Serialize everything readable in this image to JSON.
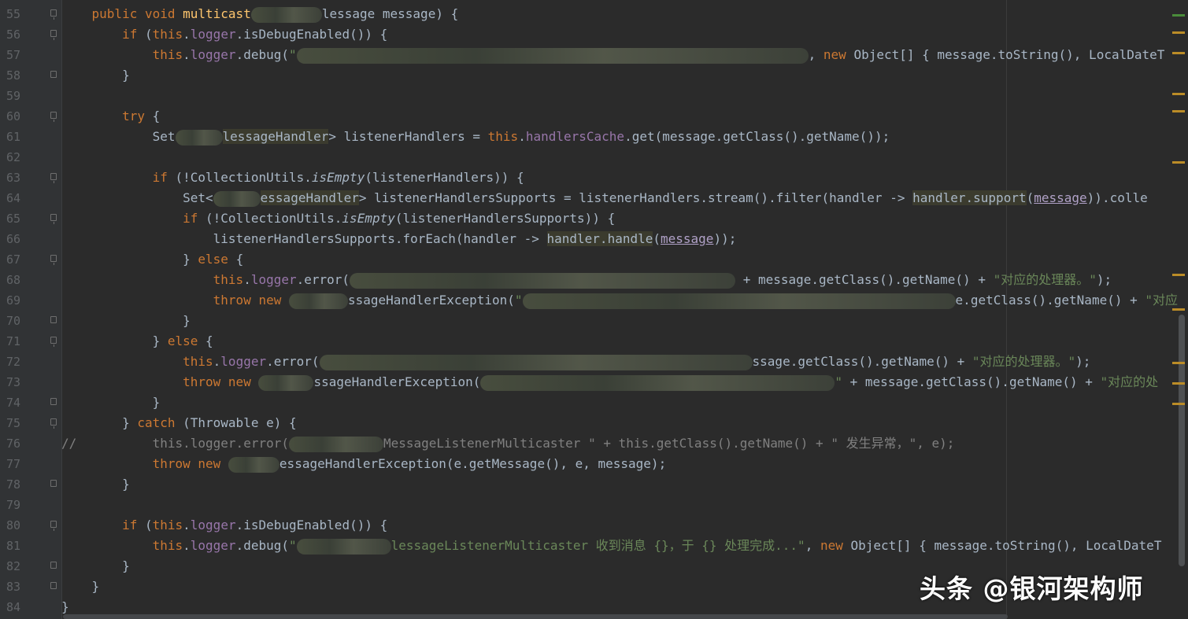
{
  "editor": {
    "lines": [
      {
        "n": "55",
        "fold": "open",
        "segs": [
          [
            "    ",
            ""
          ],
          [
            "public void ",
            "kw"
          ],
          [
            "multicast",
            "fn"
          ],
          [
            "BLUR90",
            ""
          ],
          [
            "lessage message) {",
            ""
          ]
        ]
      },
      {
        "n": "56",
        "fold": "open",
        "segs": [
          [
            "        ",
            ""
          ],
          [
            "if ",
            "kw"
          ],
          [
            "(",
            ""
          ],
          [
            "this",
            "kw"
          ],
          [
            ".",
            ""
          ],
          [
            "logger",
            "fld"
          ],
          [
            ".isDebugEnabled()) {",
            ""
          ]
        ]
      },
      {
        "n": "57",
        "fold": "",
        "segs": [
          [
            "            ",
            ""
          ],
          [
            "this",
            "kw"
          ],
          [
            ".",
            ""
          ],
          [
            "logger",
            "fld"
          ],
          [
            ".debug(",
            ""
          ],
          [
            "\"",
            "str"
          ],
          [
            "BLUR650",
            ""
          ],
          [
            ", ",
            ""
          ],
          [
            "new ",
            "kw"
          ],
          [
            "Object[] { message.toString(), LocalDateT",
            ""
          ]
        ]
      },
      {
        "n": "58",
        "fold": "closed",
        "segs": [
          [
            "        }",
            ""
          ]
        ]
      },
      {
        "n": "59",
        "fold": "",
        "segs": [
          [
            "",
            ""
          ]
        ]
      },
      {
        "n": "60",
        "fold": "open",
        "segs": [
          [
            "        ",
            ""
          ],
          [
            "try ",
            "kw"
          ],
          [
            "{",
            ""
          ]
        ]
      },
      {
        "n": "61",
        "fold": "",
        "segs": [
          [
            "            Set",
            ""
          ],
          [
            "BLUR60",
            ""
          ],
          [
            "lessageHandler",
            "hl2"
          ],
          [
            "> listenerHandlers = ",
            ""
          ],
          [
            "this",
            "kw"
          ],
          [
            ".",
            ""
          ],
          [
            "handlersCache",
            "fld"
          ],
          [
            ".get(message.getClass().getName());",
            ""
          ]
        ]
      },
      {
        "n": "62",
        "fold": "",
        "segs": [
          [
            "",
            ""
          ]
        ]
      },
      {
        "n": "63",
        "fold": "open",
        "segs": [
          [
            "            ",
            ""
          ],
          [
            "if ",
            "kw"
          ],
          [
            "(!CollectionUtils.",
            ""
          ],
          [
            "isEmpty",
            "it"
          ],
          [
            "(listenerHandlers)) {",
            ""
          ]
        ]
      },
      {
        "n": "64",
        "fold": "",
        "segs": [
          [
            "                Set<",
            ""
          ],
          [
            "BLUR60",
            ""
          ],
          [
            "essageHandler",
            "hl2"
          ],
          [
            "> listenerHandlersSupports = listenerHandlers.stream().filter(handler -> ",
            ""
          ],
          [
            "handler.support",
            "hl2"
          ],
          [
            "(",
            ""
          ],
          [
            "message",
            "ul"
          ],
          [
            ")).colle",
            ""
          ]
        ]
      },
      {
        "n": "65",
        "fold": "open",
        "segs": [
          [
            "                ",
            ""
          ],
          [
            "if ",
            "kw"
          ],
          [
            "(!CollectionUtils.",
            ""
          ],
          [
            "isEmpty",
            "it"
          ],
          [
            "(listenerHandlersSupports)) {",
            ""
          ]
        ]
      },
      {
        "n": "66",
        "fold": "",
        "segs": [
          [
            "                    listenerHandlersSupports.forEach(handler -> ",
            ""
          ],
          [
            "handler.handle",
            "hl2"
          ],
          [
            "(",
            ""
          ],
          [
            "message",
            "ul"
          ],
          [
            "));",
            ""
          ]
        ]
      },
      {
        "n": "67",
        "fold": "open",
        "segs": [
          [
            "                } ",
            ""
          ],
          [
            "else ",
            "kw"
          ],
          [
            "{",
            ""
          ]
        ]
      },
      {
        "n": "68",
        "fold": "",
        "segs": [
          [
            "                    ",
            ""
          ],
          [
            "this",
            "kw"
          ],
          [
            ".",
            ""
          ],
          [
            "logger",
            "fld"
          ],
          [
            ".error(",
            ""
          ],
          [
            "BLUR490",
            ""
          ],
          [
            " + message.getClass().getName() + ",
            ""
          ],
          [
            "\"对应的处理器。\"",
            "str"
          ],
          [
            ");",
            ""
          ]
        ]
      },
      {
        "n": "69",
        "fold": "",
        "segs": [
          [
            "                    ",
            ""
          ],
          [
            "throw new ",
            "kw"
          ],
          [
            "BLUR75",
            ""
          ],
          [
            "ssageHandlerException(",
            ""
          ],
          [
            "\"",
            "str"
          ],
          [
            "BLUR550",
            ""
          ],
          [
            "e.getClass().getName() + ",
            ""
          ],
          [
            "\"对应",
            "str"
          ]
        ]
      },
      {
        "n": "70",
        "fold": "closed",
        "segs": [
          [
            "                }",
            ""
          ]
        ]
      },
      {
        "n": "71",
        "fold": "open",
        "segs": [
          [
            "            } ",
            ""
          ],
          [
            "else ",
            "kw"
          ],
          [
            "{",
            ""
          ]
        ]
      },
      {
        "n": "72",
        "fold": "",
        "segs": [
          [
            "                ",
            ""
          ],
          [
            "this",
            "kw"
          ],
          [
            ".",
            ""
          ],
          [
            "logger",
            "fld"
          ],
          [
            ".error(",
            ""
          ],
          [
            "BLUR550",
            ""
          ],
          [
            "ssage.getClass().getName() + ",
            ""
          ],
          [
            "\"对应的处理器。\"",
            "str"
          ],
          [
            ");",
            ""
          ]
        ]
      },
      {
        "n": "73",
        "fold": "",
        "segs": [
          [
            "                ",
            ""
          ],
          [
            "throw new ",
            "kw"
          ],
          [
            "BLUR70",
            ""
          ],
          [
            "ssageHandlerException(",
            ""
          ],
          [
            "BLUR450",
            ""
          ],
          [
            "\"",
            "str"
          ],
          [
            " + message.getClass().getName() + ",
            ""
          ],
          [
            "\"对应的处",
            "str"
          ]
        ]
      },
      {
        "n": "74",
        "fold": "closed",
        "segs": [
          [
            "            }",
            ""
          ]
        ]
      },
      {
        "n": "75",
        "fold": "open",
        "segs": [
          [
            "        } ",
            ""
          ],
          [
            "catch ",
            "kw"
          ],
          [
            "(Throwable e) {",
            ""
          ]
        ]
      },
      {
        "n": "76",
        "fold": "",
        "segs": [
          [
            "//          this.logger.error(",
            "cm"
          ],
          [
            "BLUR120",
            ""
          ],
          [
            "MessageListenerMulticaster \" + this.getClass().getName() + \" 发生异常，\", e);",
            "cm"
          ]
        ]
      },
      {
        "n": "77",
        "fold": "",
        "segs": [
          [
            "            ",
            ""
          ],
          [
            "throw new ",
            "kw"
          ],
          [
            "BLUR65",
            ""
          ],
          [
            "essageHandlerException(e.getMessage(), e, message);",
            ""
          ]
        ]
      },
      {
        "n": "78",
        "fold": "closed",
        "segs": [
          [
            "        }",
            ""
          ]
        ]
      },
      {
        "n": "79",
        "fold": "",
        "segs": [
          [
            "",
            ""
          ]
        ]
      },
      {
        "n": "80",
        "fold": "open",
        "segs": [
          [
            "        ",
            ""
          ],
          [
            "if ",
            "kw"
          ],
          [
            "(",
            ""
          ],
          [
            "this",
            "kw"
          ],
          [
            ".",
            ""
          ],
          [
            "logger",
            "fld"
          ],
          [
            ".isDebugEnabled()) {",
            ""
          ]
        ]
      },
      {
        "n": "81",
        "fold": "",
        "segs": [
          [
            "            ",
            ""
          ],
          [
            "this",
            "kw"
          ],
          [
            ".",
            ""
          ],
          [
            "logger",
            "fld"
          ],
          [
            ".debug(",
            ""
          ],
          [
            "\"",
            "str"
          ],
          [
            "BLUR120",
            ""
          ],
          [
            "lessageListenerMulticaster 收到消息 {}，于 {} 处理完成...\"",
            "str"
          ],
          [
            ", ",
            ""
          ],
          [
            "new ",
            "kw"
          ],
          [
            "Object[] { message.toString(), LocalDateT",
            ""
          ]
        ]
      },
      {
        "n": "82",
        "fold": "closed",
        "segs": [
          [
            "        }",
            ""
          ]
        ]
      },
      {
        "n": "83",
        "fold": "closed",
        "segs": [
          [
            "    }",
            ""
          ]
        ]
      },
      {
        "n": "84",
        "fold": "",
        "segs": [
          [
            "}",
            ""
          ]
        ]
      }
    ]
  },
  "watermark": "头条 @银河架构师",
  "colors": {
    "background": "#2b2b2b",
    "keyword": "#cc7832",
    "field": "#9876aa",
    "string": "#6a8759",
    "method": "#ffc66d"
  }
}
